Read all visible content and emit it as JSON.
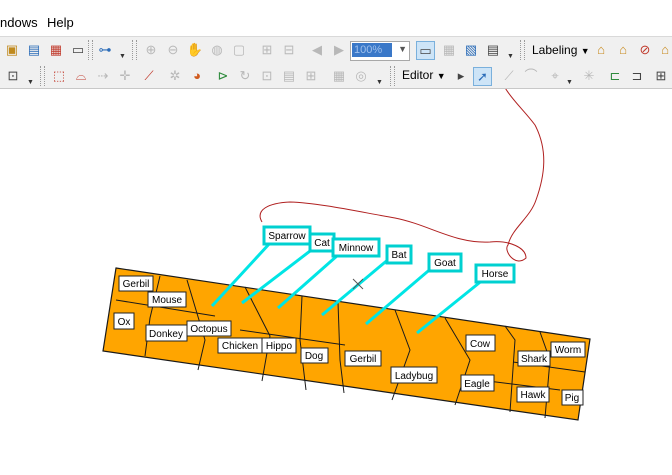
{
  "menu": {
    "windows": "ndows",
    "help": "Help"
  },
  "toolbar": {
    "scale_value": "100%",
    "labeling_label": "Labeling",
    "editor_label": "Editor"
  },
  "map": {
    "colors": {
      "polygon_fill": "#ffa500",
      "leader_line": "#00e5e5",
      "sketch_stroke": "#b02020"
    },
    "labels_in_polygons": [
      "Gerbil",
      "Mouse",
      "Ox",
      "Donkey",
      "Octopus",
      "Chicken",
      "Hippo",
      "Dog",
      "Gerbil",
      "Ladybug",
      "Cow",
      "Eagle",
      "Shark",
      "Worm",
      "Hawk",
      "Pig"
    ],
    "callout_labels": [
      "Sparrow",
      "Cat",
      "Minnow",
      "Bat",
      "Goat",
      "Horse"
    ]
  }
}
